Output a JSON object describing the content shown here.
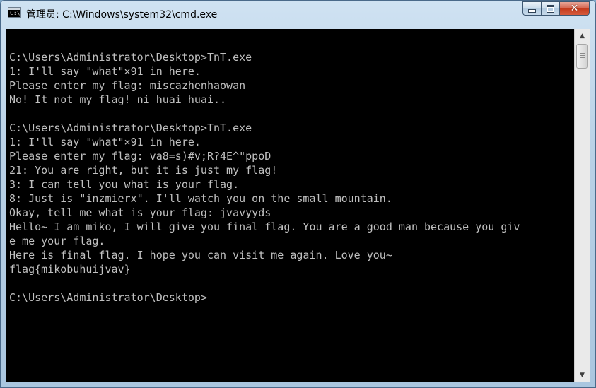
{
  "window": {
    "title": "管理员: C:\\Windows\\system32\\cmd.exe",
    "app_icon_label": "C:\\",
    "close_glyph": "✕"
  },
  "console": {
    "lines": [
      "",
      "C:\\Users\\Administrator\\Desktop>TnT.exe",
      "1: I'll say \"what\"×91 in here.",
      "Please enter my flag: miscazhenhaowan",
      "No! It not my flag! ni huai huai..",
      "",
      "C:\\Users\\Administrator\\Desktop>TnT.exe",
      "1: I'll say \"what\"×91 in here.",
      "Please enter my flag: va8=s)#v;R?4E^\"ppoD",
      "21: You are right, but it is just my flag!",
      "3: I can tell you what is your flag.",
      "8: Just is \"inzmierx\". I'll watch you on the small mountain.",
      "Okay, tell me what is your flag: jvavyyds",
      "Hello~ I am miko, I will give you final flag. You are a good man because you giv",
      "e me your flag.",
      "Here is final flag. I hope you can visit me again. Love you~",
      "flag{mikobuhuijvav}",
      "",
      "C:\\Users\\Administrator\\Desktop>"
    ]
  },
  "scrollbar": {
    "up_glyph": "▲",
    "down_glyph": "▼"
  }
}
